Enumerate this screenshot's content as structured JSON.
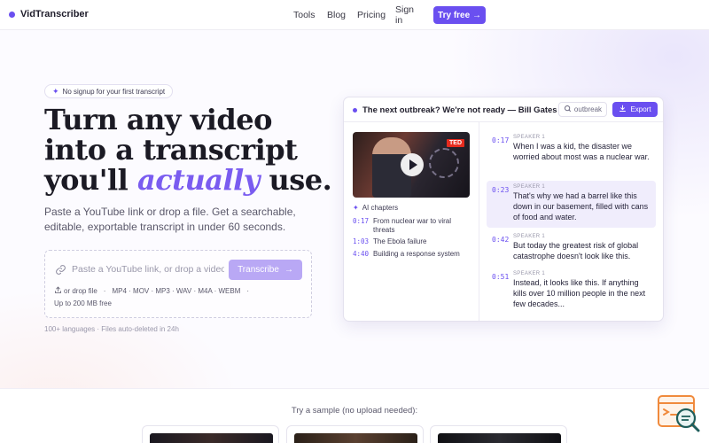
{
  "nav": {
    "brand": "VidTranscriber",
    "links": [
      "Tools",
      "Blog",
      "Pricing",
      "Sign in"
    ],
    "cta": "Try free →"
  },
  "hero": {
    "badge": "No signup for your first transcript",
    "headline_1": "Turn any video",
    "headline_2": "into a transcript",
    "headline_3_pre": "you'll ",
    "headline_3_accent": "actually",
    "headline_3_post": " use.",
    "subtext": "Paste a YouTube link or drop a file. Get a searchable, editable, exportable transcript in under 60 seconds."
  },
  "upload": {
    "placeholder": "Paste a YouTube link, or drop a video",
    "button": "Transcribe",
    "drop_label": "or drop file",
    "formats": "MP4 · MOV · MP3 · WAV · M4A · WEBM",
    "limit": "Up to 200 MB free",
    "footnote": "100+ languages · Files auto-deleted in 24h"
  },
  "demo": {
    "title": "The next outbreak? We're not ready — Bill Gates",
    "search_chip": "outbreak",
    "export": "Export",
    "thumb_badge": "TED",
    "chapters_label": "AI chapters",
    "chapters": [
      {
        "ts": "0:17",
        "text": "From nuclear war to viral threats"
      },
      {
        "ts": "1:03",
        "text": "The Ebola failure"
      },
      {
        "ts": "4:40",
        "text": "Building a response system"
      }
    ],
    "segments": [
      {
        "ts": "0:17",
        "speaker": "SPEAKER 1",
        "text": "When I was a kid, the disaster we worried about most was a nuclear war."
      },
      {
        "ts": "0:23",
        "speaker": "SPEAKER 1",
        "text": "That's why we had a barrel like this down in our basement, filled with cans of food and water."
      },
      {
        "ts": "0:42",
        "speaker": "SPEAKER 1",
        "text": "But today the greatest risk of global catastrophe doesn't look like this."
      },
      {
        "ts": "0:51",
        "speaker": "SPEAKER 1",
        "text": "Instead, it looks like this. If anything kills over 10 million people in the next few decades..."
      }
    ]
  },
  "samples": {
    "label": "Try a sample (no upload needed):"
  },
  "colors": {
    "accent": "#6a4ff0",
    "accent_light": "#b9a8f5",
    "ted_red": "#e62b1e"
  }
}
